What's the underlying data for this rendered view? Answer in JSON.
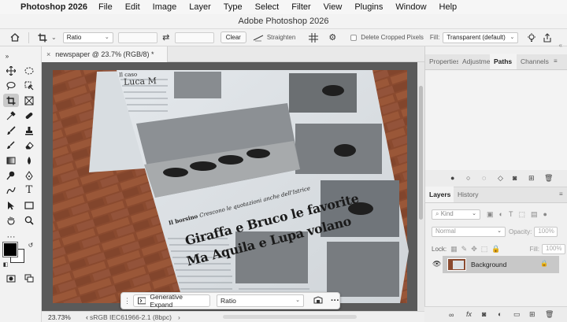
{
  "menubar": {
    "app_name": "Photoshop 2026",
    "items": [
      "File",
      "Edit",
      "Image",
      "Layer",
      "Type",
      "Select",
      "Filter",
      "View",
      "Plugins",
      "Window",
      "Help"
    ]
  },
  "window": {
    "title": "Adobe Photoshop 2026"
  },
  "options": {
    "ratio_select": "Ratio",
    "clear_label": "Clear",
    "straighten_label": "Straighten",
    "delete_cropped_label": "Delete Cropped Pixels",
    "fill_label": "Fill:",
    "fill_value": "Transparent (default)"
  },
  "document": {
    "tab_title": "newspaper @ 23.7% (RGB/8) *"
  },
  "taskbar": {
    "generative_expand_label": "Generative Expand",
    "ratio_value": "Ratio"
  },
  "status": {
    "zoom": "23.73%",
    "profile": "sRGB IEC61966-2.1 (8bpc)"
  },
  "panels": {
    "top_tabs": [
      "Properties",
      "Adjustments",
      "Paths",
      "Channels"
    ],
    "active_top_tab": "Paths",
    "layers_tabs": [
      "Layers",
      "History"
    ],
    "kind_label": "Kind",
    "blend_mode": "Normal",
    "opacity_label": "Opacity:",
    "opacity_value": "100%",
    "lock_label": "Lock:",
    "fill_label": "Fill:",
    "fill_value": "100%",
    "layer_name": "Background"
  },
  "newspaper": {
    "header_small": "Il caso",
    "header_name": "Luca M",
    "column_header": "Il borsino",
    "subhead": "Crescono le quotazioni anche dell'Istrice",
    "headline_line1": "Giraffa e Bruco le favorite",
    "headline_line2": "Ma Aquila e Lupa volano"
  },
  "colors": {
    "accent": "#2b6fd6",
    "brick": "#8a4a2f",
    "canvas_bg": "#5a5a5a"
  }
}
